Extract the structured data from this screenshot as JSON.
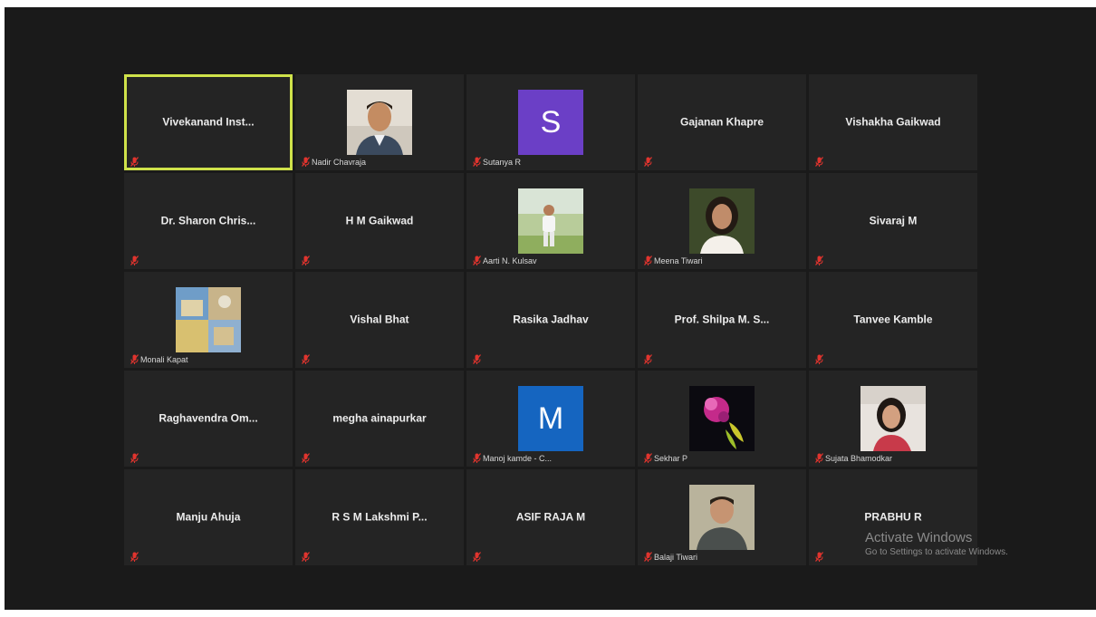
{
  "participants": [
    {
      "name": "Vivekanand Inst...",
      "active": true
    },
    {
      "tag": "Nadir Chavraja",
      "avatar": "photo-man-portrait"
    },
    {
      "tag": "Sutanya R",
      "avatar": "letter",
      "letter": "S",
      "color": "#6b3fc6"
    },
    {
      "name": "Gajanan Khapre"
    },
    {
      "name": "Vishakha Gaikwad"
    },
    {
      "name": "Dr. Sharon Chris..."
    },
    {
      "name": "H M Gaikwad"
    },
    {
      "tag": "Aarti N. Kulsav",
      "avatar": "photo-child-outdoor"
    },
    {
      "tag": "Meena Tiwari",
      "avatar": "photo-woman-portrait"
    },
    {
      "name": "Sivaraj M"
    },
    {
      "tag": "Monali Kapat",
      "avatar": "photo-collage"
    },
    {
      "name": "Vishal Bhat"
    },
    {
      "name": "Rasika Jadhav"
    },
    {
      "name": "Prof. Shilpa M. S..."
    },
    {
      "name": "Tanvee Kamble"
    },
    {
      "name": "Raghavendra  Om..."
    },
    {
      "name": "megha ainapurkar"
    },
    {
      "tag": "Manoj kamde - C...",
      "avatar": "letter",
      "letter": "M",
      "color": "#1565c0"
    },
    {
      "tag": "Sekhar P",
      "avatar": "photo-flower"
    },
    {
      "tag": "Sujata Bhamodkar",
      "avatar": "photo-woman-selfie"
    },
    {
      "name": "Manju Ahuja"
    },
    {
      "name": "R S M Lakshmi P..."
    },
    {
      "name": "ASIF RAJA M"
    },
    {
      "tag": "Balaji Tiwari",
      "avatar": "photo-man-portrait-2"
    },
    {
      "name": "PRABHU R"
    }
  ],
  "watermark": {
    "line1": "Activate Windows",
    "line2": "Go to Settings to activate Windows."
  },
  "colors": {
    "background": "#1a1a1a",
    "tile": "#242424",
    "active_border": "#cfe24a",
    "mute_icon": "#e0342e"
  }
}
